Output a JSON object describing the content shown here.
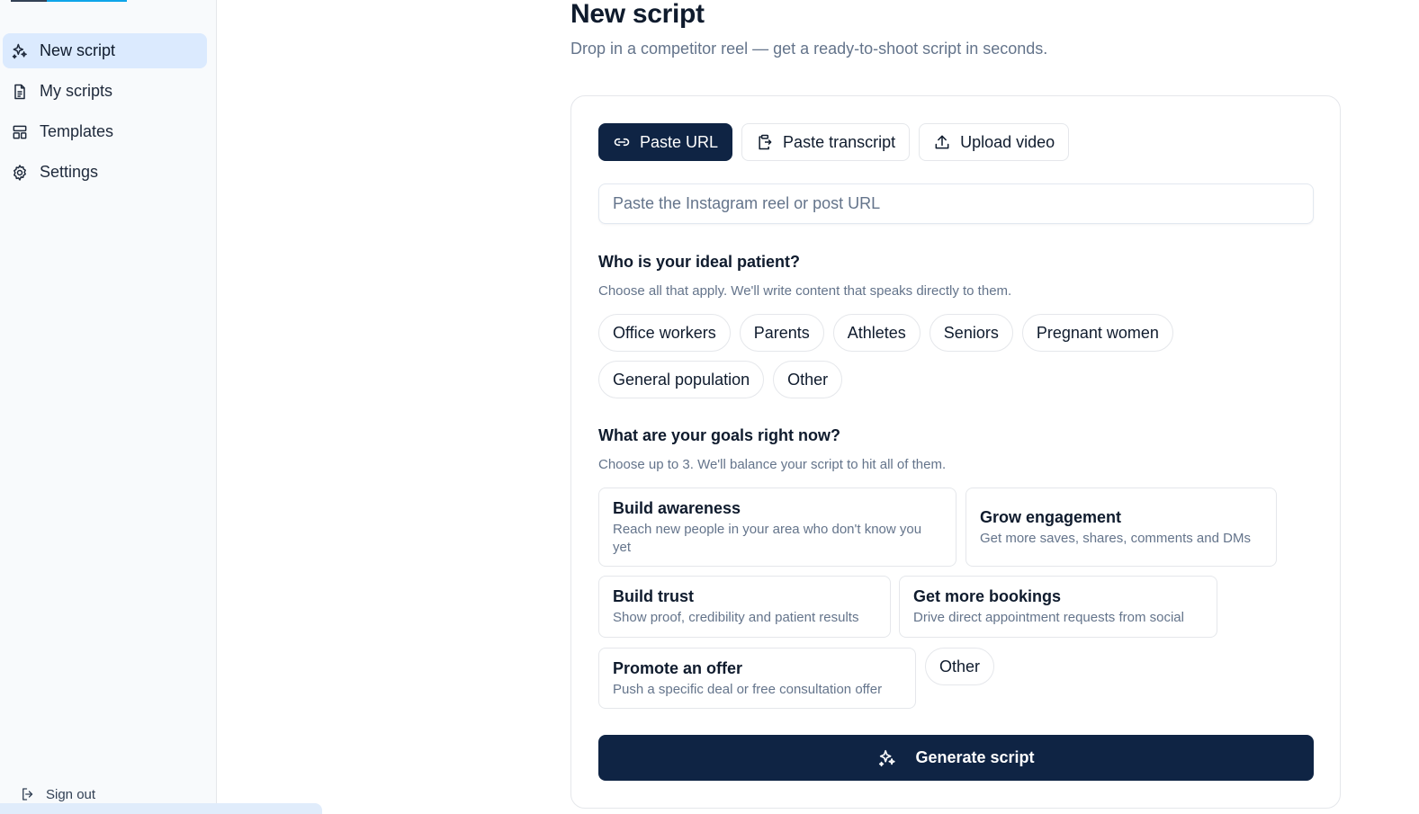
{
  "sidebar": {
    "items": [
      {
        "label": "New script",
        "icon": "sparkles-icon",
        "active": true
      },
      {
        "label": "My scripts",
        "icon": "document-icon"
      },
      {
        "label": "Templates",
        "icon": "layout-icon"
      },
      {
        "label": "Settings",
        "icon": "gear-icon"
      }
    ],
    "signout_label": "Sign out"
  },
  "header": {
    "title": "New script",
    "subtitle": "Drop in a competitor reel — get a ready-to-shoot script in seconds."
  },
  "tabs": [
    {
      "label": "Paste URL",
      "icon": "link-icon",
      "active": true
    },
    {
      "label": "Paste transcript",
      "icon": "clipboard-icon"
    },
    {
      "label": "Upload video",
      "icon": "upload-icon"
    }
  ],
  "url_input": {
    "placeholder": "Paste the Instagram reel or post URL",
    "value": ""
  },
  "patients": {
    "heading": "Who is your ideal patient?",
    "help": "Choose all that apply. We'll write content that speaks directly to them.",
    "options": [
      "Office workers",
      "Parents",
      "Athletes",
      "Seniors",
      "Pregnant women",
      "General population",
      "Other"
    ]
  },
  "goals": {
    "heading": "What are your goals right now?",
    "help": "Choose up to 3. We'll balance your script to hit all of them.",
    "options": [
      {
        "title": "Build awareness",
        "desc": "Reach new people in your area who don't know you yet"
      },
      {
        "title": "Grow engagement",
        "desc": "Get more saves, shares, comments and DMs"
      },
      {
        "title": "Build trust",
        "desc": "Show proof, credibility and patient results"
      },
      {
        "title": "Get more bookings",
        "desc": "Drive direct appointment requests from social"
      },
      {
        "title": "Promote an offer",
        "desc": "Push a specific deal or free consultation offer"
      }
    ],
    "other_label": "Other"
  },
  "generate_label": "Generate script",
  "colors": {
    "primary": "#0f2444",
    "active_nav": "#dbeafe",
    "muted_text": "#64748b",
    "border": "#e5e7eb"
  }
}
